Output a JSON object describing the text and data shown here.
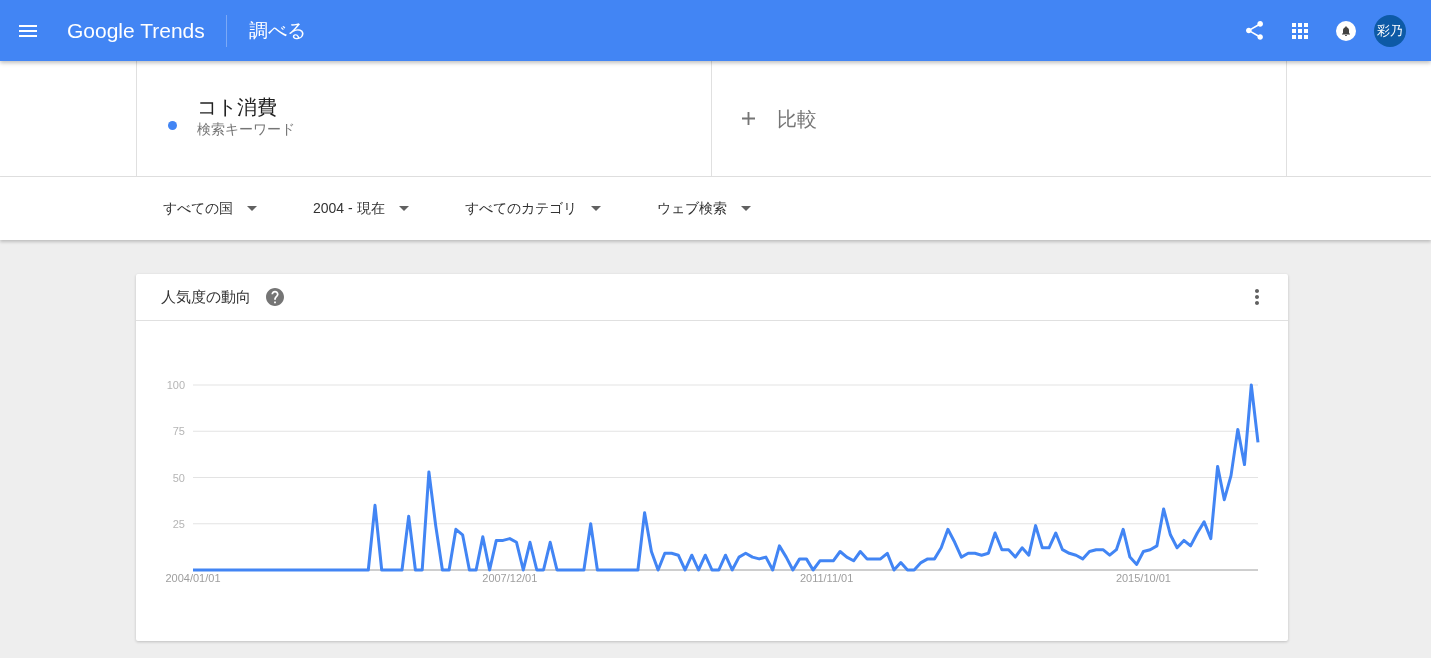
{
  "header": {
    "logo": "Google Trends",
    "page_title": "調べる",
    "avatar": "彩乃"
  },
  "search_term": {
    "term": "コト消費",
    "type_label": "検索キーワード",
    "color": "#4285f4"
  },
  "compare": {
    "label": "比較"
  },
  "filters": [
    "すべての国",
    "2004 - 現在",
    "すべてのカテゴリ",
    "ウェブ検索"
  ],
  "interest_card": {
    "title": "人気度の動向",
    "chart_data": {
      "type": "line",
      "grid": true,
      "ylim": [
        0,
        100
      ],
      "yticks": [
        25,
        50,
        75,
        100
      ],
      "categories": [
        "2004/01/01",
        null,
        null,
        null,
        null,
        null,
        null,
        null,
        null,
        null,
        null,
        null,
        null,
        null,
        null,
        null,
        null,
        null,
        null,
        null,
        null,
        null,
        null,
        null,
        null,
        null,
        null,
        null,
        null,
        null,
        null,
        null,
        null,
        null,
        null,
        null,
        null,
        null,
        null,
        null,
        null,
        null,
        null,
        null,
        null,
        null,
        null,
        "2007/12/01",
        null,
        null,
        null,
        null,
        null,
        null,
        null,
        null,
        null,
        null,
        null,
        null,
        null,
        null,
        null,
        null,
        null,
        null,
        null,
        null,
        null,
        null,
        null,
        null,
        null,
        null,
        null,
        null,
        null,
        null,
        null,
        null,
        null,
        null,
        null,
        null,
        null,
        null,
        null,
        null,
        null,
        null,
        null,
        null,
        null,
        null,
        "2011/11/01",
        null,
        null,
        null,
        null,
        null,
        null,
        null,
        null,
        null,
        null,
        null,
        null,
        null,
        null,
        null,
        null,
        null,
        null,
        null,
        null,
        null,
        null,
        null,
        null,
        null,
        null,
        null,
        null,
        null,
        null,
        null,
        null,
        null,
        null,
        null,
        null,
        null,
        null,
        null,
        null,
        null,
        null,
        null,
        null,
        null,
        null,
        "2015/10/01",
        null,
        null,
        null,
        null,
        null,
        null,
        null,
        null,
        null,
        null,
        null,
        null,
        null,
        null,
        null,
        null,
        null
      ],
      "series": [
        {
          "color": "#4285f4",
          "values": [
            0,
            0,
            0,
            0,
            0,
            0,
            0,
            0,
            0,
            0,
            0,
            0,
            0,
            0,
            0,
            0,
            0,
            0,
            0,
            0,
            0,
            0,
            0,
            0,
            0,
            0,
            0,
            35,
            0,
            0,
            0,
            0,
            29,
            0,
            0,
            53,
            24,
            0,
            0,
            22,
            19,
            0,
            0,
            18,
            0,
            16,
            16,
            17,
            15,
            0,
            15,
            0,
            0,
            15,
            0,
            0,
            0,
            0,
            0,
            25,
            0,
            0,
            0,
            0,
            0,
            0,
            0,
            31,
            10,
            0,
            9,
            9,
            8,
            0,
            8,
            0,
            8,
            0,
            0,
            8,
            0,
            7,
            9,
            7,
            6,
            7,
            0,
            13,
            7,
            0,
            6,
            6,
            0,
            5,
            5,
            5,
            10,
            7,
            5,
            10,
            6,
            6,
            6,
            9,
            0,
            4,
            0,
            0,
            4,
            6,
            6,
            12,
            22,
            15,
            7,
            9,
            9,
            8,
            9,
            20,
            11,
            11,
            7,
            12,
            8,
            24,
            12,
            12,
            20,
            11,
            9,
            8,
            6,
            10,
            11,
            11,
            8,
            11,
            22,
            7,
            3,
            10,
            11,
            13,
            33,
            19,
            12,
            16,
            13,
            20,
            26,
            17,
            56,
            38,
            51,
            76,
            57,
            100,
            69
          ]
        }
      ]
    }
  }
}
